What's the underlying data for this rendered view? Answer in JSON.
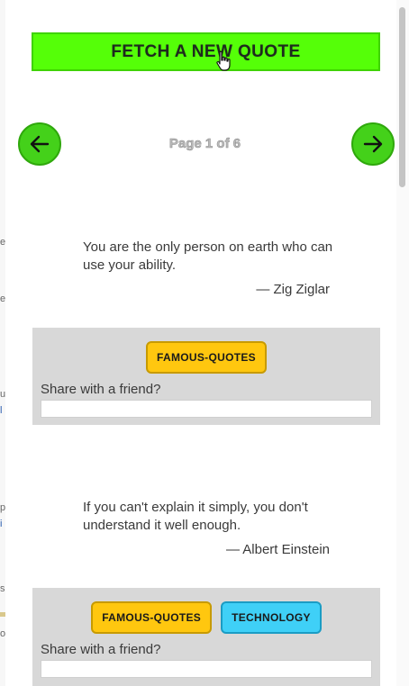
{
  "header": {
    "fetch_button_label": "FETCH A NEW QUOTE"
  },
  "pagination": {
    "page_text": "Page 1 of 6"
  },
  "quotes": [
    {
      "text": "You are the only person on earth who can use your ability.",
      "author": "— Zig Ziglar",
      "tags": [
        "FAMOUS-QUOTES"
      ],
      "share_label": "Share with a friend?",
      "share_value": ""
    },
    {
      "text": "If you can't explain it simply, you don't understand it well enough.",
      "author": "— Albert Einstein",
      "tags": [
        "FAMOUS-QUOTES",
        "TECHNOLOGY"
      ],
      "share_label": "Share with a friend?",
      "share_value": ""
    }
  ],
  "icons": {
    "prev": "arrow-left-icon",
    "next": "arrow-right-icon",
    "cursor": "hand-pointer-icon"
  },
  "colors": {
    "fetch_button": "#55ff08",
    "nav_buttons": "#44d11a",
    "card_background": "#d8d8d8",
    "tag_famous": "#ffc70f",
    "tag_technology": "#3fd0f7"
  }
}
